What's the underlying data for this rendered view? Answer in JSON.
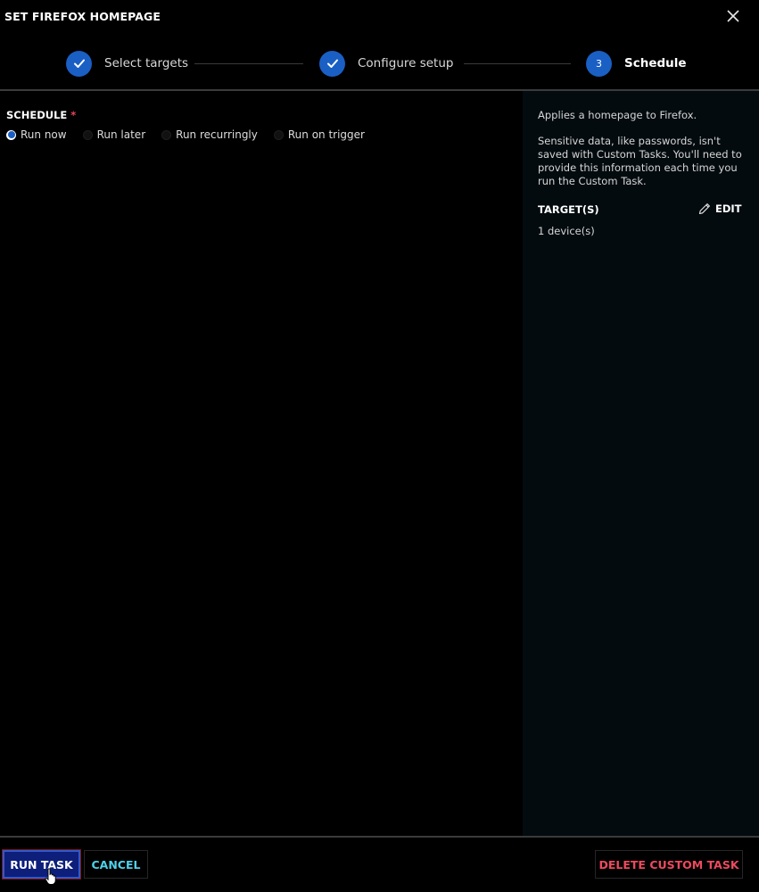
{
  "dialog": {
    "title": "SET FIREFOX HOMEPAGE"
  },
  "stepper": {
    "steps": [
      {
        "label": "Select targets",
        "state": "complete",
        "icon": "check-icon"
      },
      {
        "label": "Configure setup",
        "state": "complete",
        "icon": "check-icon"
      },
      {
        "label": "Schedule",
        "state": "active",
        "number": "3"
      }
    ]
  },
  "schedule": {
    "label": "SCHEDULE",
    "required_mark": "*",
    "options": [
      {
        "label": "Run now",
        "selected": true
      },
      {
        "label": "Run later",
        "selected": false
      },
      {
        "label": "Run recurringly",
        "selected": false
      },
      {
        "label": "Run on trigger",
        "selected": false
      }
    ]
  },
  "side": {
    "desc1": "Applies a homepage to Firefox.",
    "desc2": "Sensitive data, like passwords, isn't saved with Custom Tasks. You'll need to provide this information each time you run the Custom Task.",
    "targets_label": "TARGET(S)",
    "edit_label": "EDIT",
    "targets_value": "1 device(s)"
  },
  "footer": {
    "run_label": "RUN TASK",
    "cancel_label": "CANCEL",
    "delete_label": "DELETE CUSTOM TASK"
  },
  "colors": {
    "accent": "#1a5fc4",
    "run_button_bg": "#0d1f7a",
    "cancel_text": "#4fd0ea",
    "delete_text": "#ec4a5e",
    "required": "#e8455b"
  }
}
